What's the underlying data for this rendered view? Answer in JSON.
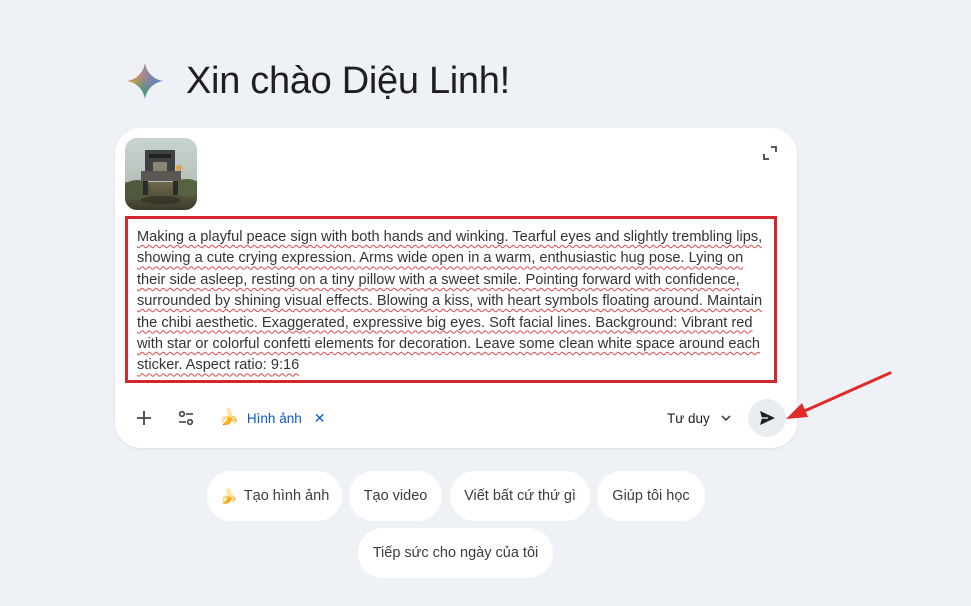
{
  "greeting": {
    "text": "Xin chào Diệu Linh!",
    "icon": "gemini-spark-icon"
  },
  "prompt": {
    "attachment_icon": "image-thumbnail",
    "text": "Making a playful peace sign with both hands and winking. Tearful eyes and slightly trembling lips, showing a cute crying expression. Arms wide open in a warm, enthusiastic hug pose. Lying on their side asleep, resting on a tiny pillow with a sweet smile. Pointing forward with confidence, surrounded by shining visual effects. Blowing a kiss, with heart symbols floating around. Maintain the chibi aesthetic. Exaggerated, expressive big eyes. Soft facial lines. Background: Vibrant red with star or colorful confetti elements for decoration. Leave some clean white space around each sticker. Aspect ratio: 9:16",
    "highlight_color": "#d3262d"
  },
  "toolbar": {
    "tool_chip": {
      "emoji": "🍌",
      "label": "Hình ảnh",
      "close": "✕"
    },
    "mode": "Tư duy",
    "send_icon": "send-icon"
  },
  "suggestions": [
    {
      "emoji": "🍌",
      "label": "Tạo hình ảnh"
    },
    {
      "emoji": "",
      "label": "Tạo video"
    },
    {
      "emoji": "",
      "label": "Viết bất cứ thứ gì"
    },
    {
      "emoji": "",
      "label": "Giúp tôi học"
    },
    {
      "emoji": "",
      "label": "Tiếp sức cho ngày của tôi"
    }
  ],
  "colors": {
    "background": "#eef1f6",
    "accent_blue": "#0b57d0",
    "annotation_red": "#e02a2a"
  }
}
